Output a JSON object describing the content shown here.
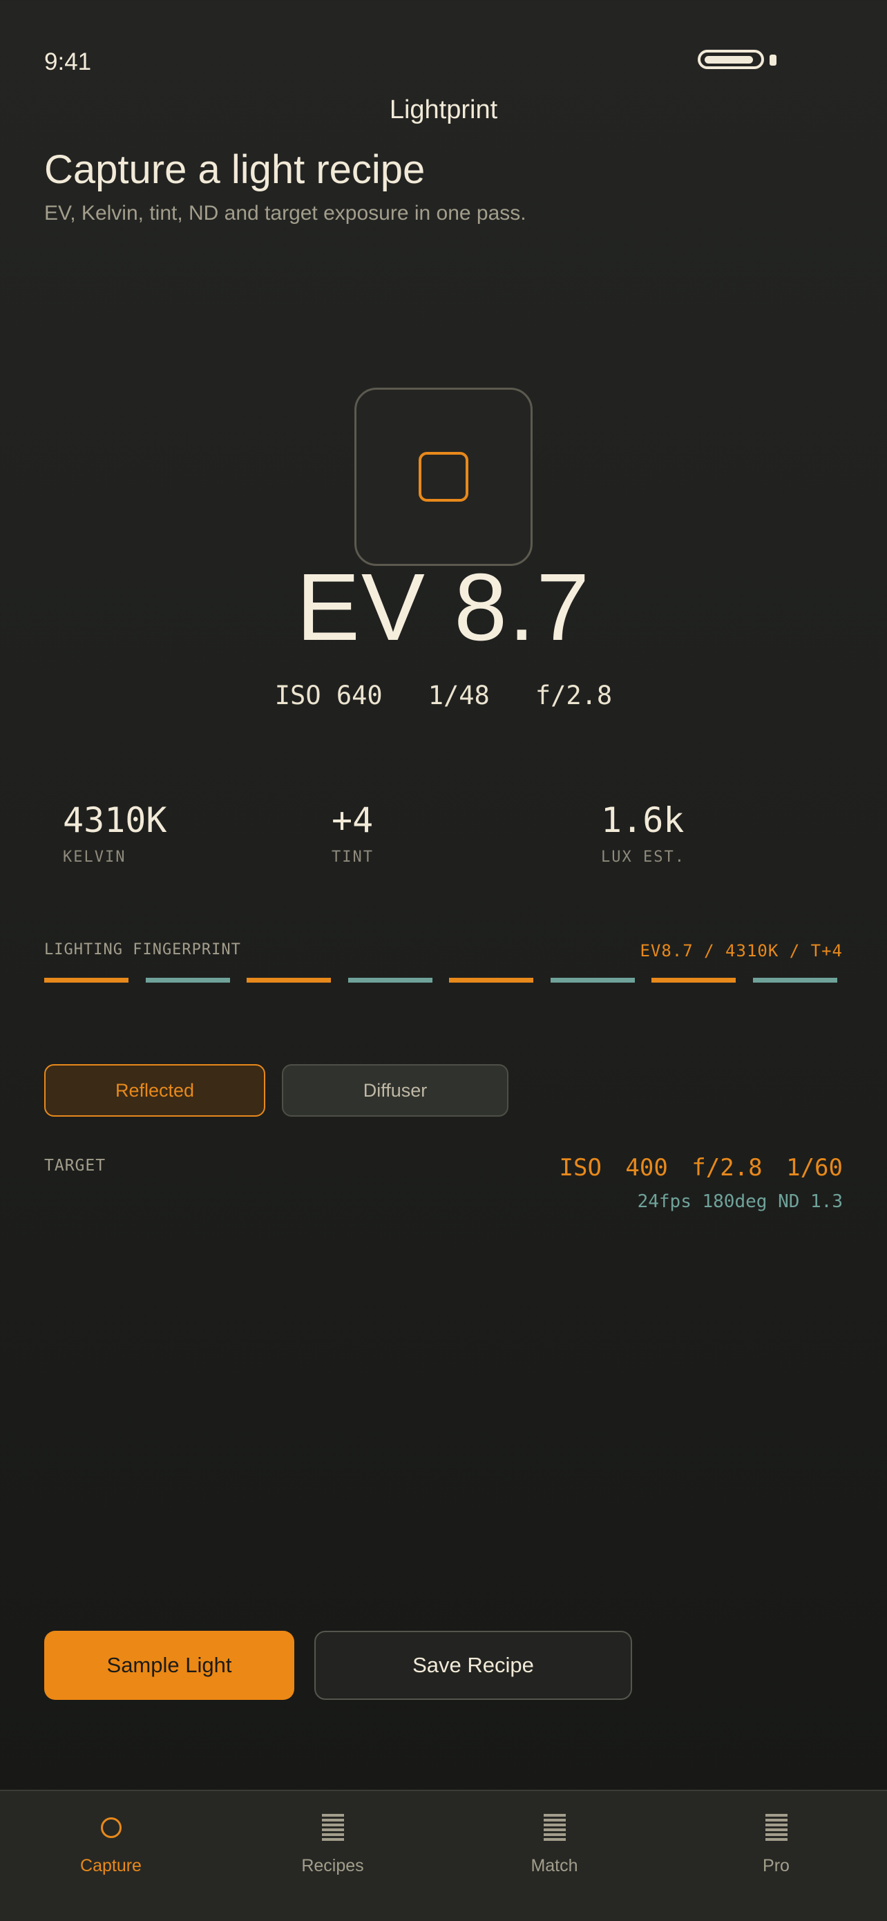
{
  "status_bar": {
    "time": "9:41"
  },
  "app": {
    "title": "Lightprint"
  },
  "header": {
    "title": "Capture a light recipe",
    "subtitle": "EV, Kelvin, tint, ND and target exposure in one pass."
  },
  "meter": {
    "icon": "meter-square-icon",
    "ev": "EV 8.7",
    "iso": "ISO 640",
    "shutter": "1/48",
    "aperture": "f/2.8"
  },
  "stats": [
    {
      "value": "4310K",
      "label": "KELVIN"
    },
    {
      "value": "+4",
      "label": "TINT"
    },
    {
      "value": "1.6k",
      "label": "LUX EST."
    }
  ],
  "fingerprint": {
    "label": "LIGHTING FINGERPRINT",
    "value": "EV8.7 / 4310K / T+4",
    "bar_colors": [
      "#e8891b",
      "#6fa39a",
      "#e8891b",
      "#6fa39a",
      "#e8891b",
      "#6fa39a",
      "#e8891b",
      "#6fa39a"
    ]
  },
  "modes": {
    "reflected": "Reflected",
    "diffuser": "Diffuser",
    "selected": "Reflected"
  },
  "target": {
    "label": "TARGET",
    "primary": "ISO 400  f/2.8  1/60",
    "secondary": "24fps 180deg  ND 1.3"
  },
  "actions": {
    "sample": "Sample Light",
    "save": "Save Recipe"
  },
  "tabs": [
    {
      "label": "Capture",
      "icon": "circle-icon",
      "active": true
    },
    {
      "label": "Recipes",
      "icon": "list-icon",
      "active": false
    },
    {
      "label": "Match",
      "icon": "list-icon",
      "active": false
    },
    {
      "label": "Pro",
      "icon": "list-icon",
      "active": false
    }
  ],
  "colors": {
    "accent": "#e8891b",
    "teal": "#6fa39a",
    "background": "#1f201e",
    "text": "#f2ead8"
  }
}
